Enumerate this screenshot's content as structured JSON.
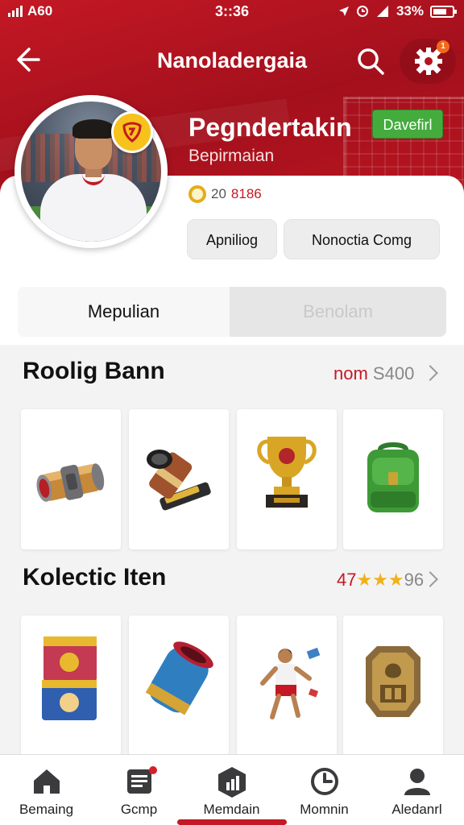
{
  "status": {
    "carrier": "A60",
    "time": "3::36",
    "battery": "33%"
  },
  "header": {
    "title": "Nanoladergaia",
    "notification_count": "1"
  },
  "profile": {
    "name": "Pegndertakin",
    "subtitle": "Bepirmaian",
    "tag": "Davefirl",
    "coins_primary": "20",
    "coins_secondary": "8186"
  },
  "actions": {
    "left": "Apniliog",
    "right": "Nonoctia Comg"
  },
  "segments": {
    "active": "Mepulian",
    "inactive": "Benolam"
  },
  "sections": [
    {
      "title": "Roolig Bann",
      "link_accent": "nom",
      "link_rest": "S400",
      "items": [
        "cylinder-bolt",
        "cannon-launcher",
        "gold-trophy",
        "green-backpack"
      ]
    },
    {
      "title": "Kolectic Iten",
      "link_accent": "47",
      "stars": "★★★",
      "link_rest": "96",
      "items": [
        "card-boxes",
        "blue-canister",
        "player-figure",
        "bronze-shield"
      ]
    }
  ],
  "bottom_nav": [
    {
      "label": "Bemaing",
      "icon": "home-icon"
    },
    {
      "label": "Gcmp",
      "icon": "clipboard-icon",
      "has_dot": true
    },
    {
      "label": "Memdain",
      "icon": "chart-hexagon-icon"
    },
    {
      "label": "Momnin",
      "icon": "clock-icon"
    },
    {
      "label": "Aledanrl",
      "icon": "person-icon"
    }
  ],
  "colors": {
    "brand_red": "#c41825",
    "accent_green": "#43ac3d",
    "coin_gold": "#e3ad1c"
  }
}
